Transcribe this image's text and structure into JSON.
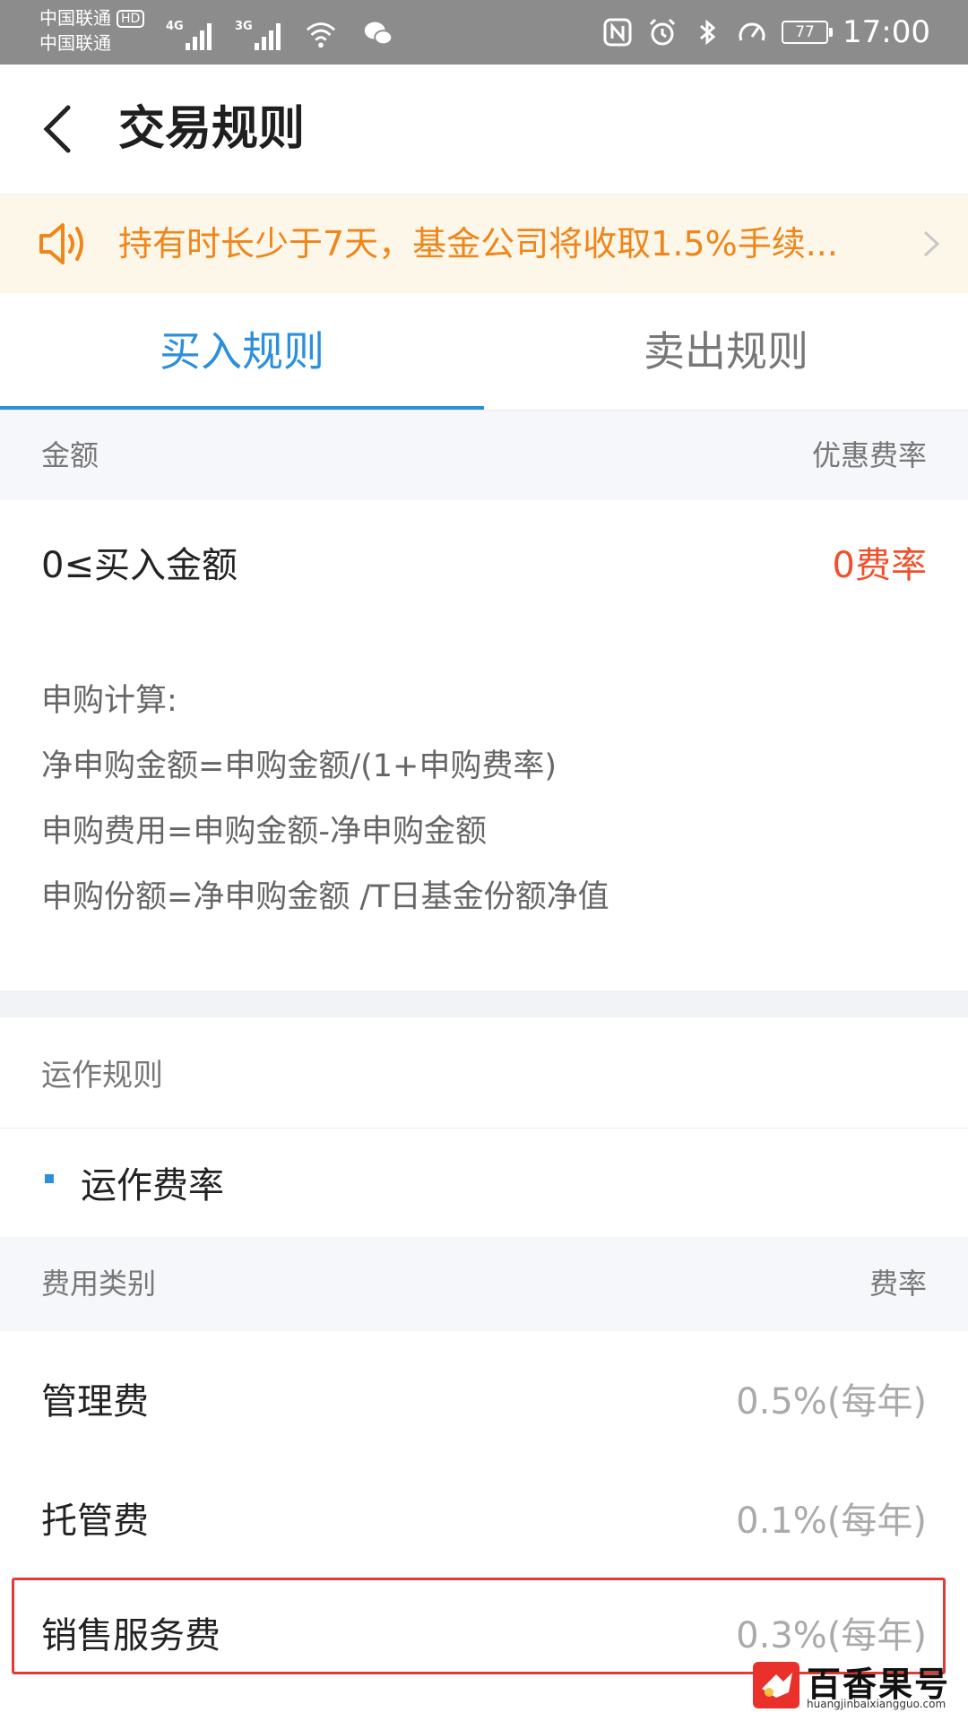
{
  "status_bar": {
    "carrier_1": "中国联通",
    "hd_badge": "HD",
    "carrier_2": "中国联通",
    "signal_1_label": "4G",
    "signal_2_label": "3G",
    "battery": "77",
    "time": "17:00"
  },
  "header": {
    "title": "交易规则"
  },
  "notice": {
    "text": "持有时长少于7天，基金公司将收取1.5%手续..."
  },
  "tabs": [
    {
      "label": "买入规则",
      "active": true
    },
    {
      "label": "卖出规则",
      "active": false
    }
  ],
  "buy_table": {
    "header_left": "金额",
    "header_right": "优惠费率",
    "row_label": "0≤买入金额",
    "row_value": "0费率"
  },
  "formula": {
    "title": "申购计算:",
    "lines": [
      "净申购金额=申购金额/(1+申购费率)",
      "申购费用=申购金额-净申购金额",
      "申购份额=净申购金额 /T日基金份额净值"
    ]
  },
  "operations": {
    "title": "运作规则",
    "subtitle": "运作费率",
    "header_left": "费用类别",
    "header_right": "费率",
    "rows": [
      {
        "label": "管理费",
        "value": "0.5%(每年)"
      },
      {
        "label": "托管费",
        "value": "0.1%(每年)"
      },
      {
        "label": "销售服务费",
        "value": "0.3%(每年)"
      }
    ]
  },
  "watermark": {
    "title": "百香果号",
    "url": "huangjinbaixiangguo.com"
  },
  "colors": {
    "accent_blue": "#2c8fdc",
    "notice_orange": "#f08519",
    "rate_red": "#f0502b",
    "highlight_red": "#e23b36"
  }
}
